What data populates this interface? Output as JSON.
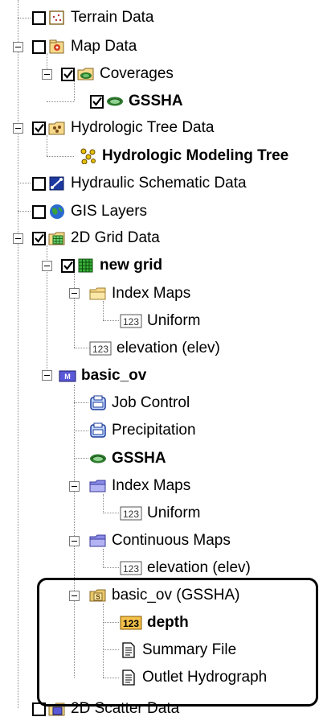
{
  "tree": {
    "terrain_data": "Terrain Data",
    "map_data": "Map Data",
    "coverages": "Coverages",
    "gssha_coverage": "GSSHA",
    "hydrologic_tree_data": "Hydrologic Tree Data",
    "hydrologic_modeling_tree": "Hydrologic Modeling Tree",
    "hydraulic_schematic_data": "Hydraulic Schematic Data",
    "gis_layers": "GIS Layers",
    "grid_data_2d": "2D Grid Data",
    "new_grid": "new grid",
    "index_maps_1": "Index Maps",
    "uniform_1": "Uniform",
    "elevation_1": "elevation (elev)",
    "basic_ov": "basic_ov",
    "job_control": "Job Control",
    "precipitation": "Precipitation",
    "gssha_model": "GSSHA",
    "index_maps_2": "Index Maps",
    "uniform_2": "Uniform",
    "continuous_maps": "Continuous Maps",
    "elevation_2": "elevation (elev)",
    "basic_ov_gssha": "basic_ov (GSSHA)",
    "depth": "depth",
    "summary_file": "Summary File",
    "outlet_hydrograph": "Outlet Hydrograph",
    "scatter_data_2d": "2D Scatter Data",
    "dataset_badge": "123"
  },
  "states": {
    "terrain_data_checked": false,
    "map_data_checked": false,
    "coverages_checked": true,
    "gssha_coverage_checked": true,
    "hydrologic_tree_data_checked": true,
    "hydraulic_schematic_data_checked": false,
    "gis_layers_checked": false,
    "grid_data_2d_checked": true,
    "new_grid_checked": true
  }
}
